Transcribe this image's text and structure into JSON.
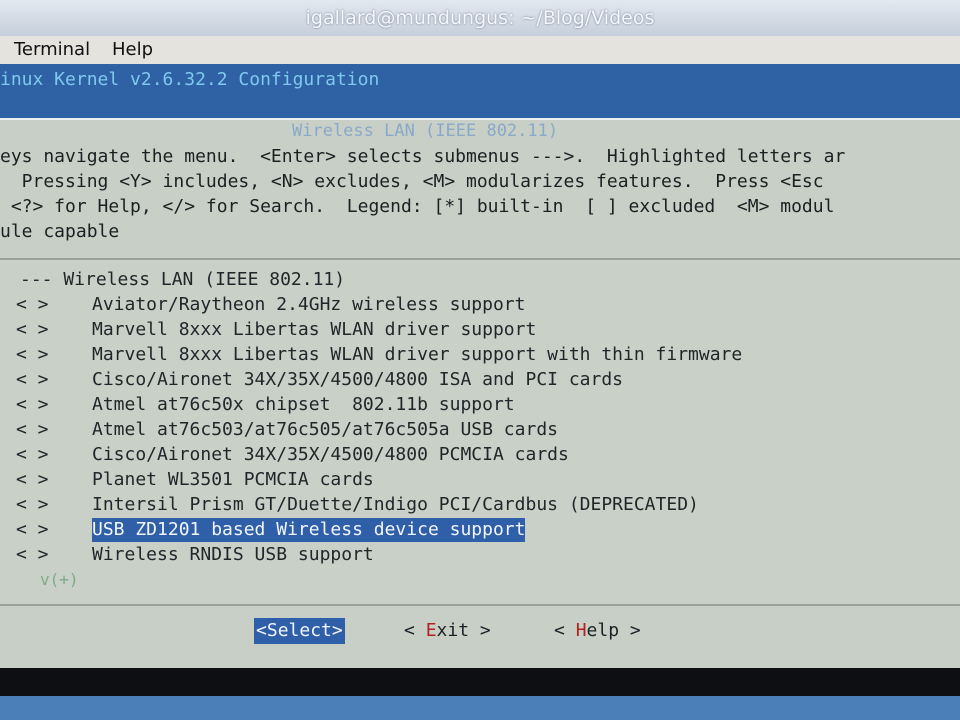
{
  "window": {
    "title": "igallard@mundungus: ~/Blog/Videos"
  },
  "menubar": {
    "terminal": "Terminal",
    "help": "Help"
  },
  "config": {
    "title": "inux Kernel v2.6.32.2 Configuration"
  },
  "dialog": {
    "header": "Wireless LAN (IEEE 802.11)",
    "help_lines": [
      "eys navigate the menu.  <Enter> selects submenus --->.  Highlighted letters ar",
      "  Pressing <Y> includes, <N> excludes, <M> modularizes features.  Press <Esc",
      " <?> for Help, </> for Search.  Legend: [*] built-in  [ ] excluded  <M> modul",
      "ule capable"
    ]
  },
  "menu": {
    "section": "--- Wireless LAN (IEEE 802.11)",
    "items": [
      {
        "mark": "< >",
        "label": "Aviator/Raytheon 2.4GHz wireless support"
      },
      {
        "mark": "< >",
        "label": "Marvell 8xxx Libertas WLAN driver support"
      },
      {
        "mark": "< >",
        "label": "Marvell 8xxx Libertas WLAN driver support with thin firmware"
      },
      {
        "mark": "< >",
        "label": "Cisco/Aironet 34X/35X/4500/4800 ISA and PCI cards"
      },
      {
        "mark": "< >",
        "label": "Atmel at76c50x chipset  802.11b support"
      },
      {
        "mark": "< >",
        "label": "Atmel at76c503/at76c505/at76c505a USB cards"
      },
      {
        "mark": "< >",
        "label": "Cisco/Aironet 34X/35X/4500/4800 PCMCIA cards"
      },
      {
        "mark": "< >",
        "label": "Planet WL3501 PCMCIA cards"
      },
      {
        "mark": "< >",
        "label": "Intersil Prism GT/Duette/Indigo PCI/Cardbus (DEPRECATED)"
      },
      {
        "mark": "< >",
        "label": "USB ZD1201 based Wireless device support",
        "selected": true
      },
      {
        "mark": "< >",
        "label": "Wireless RNDIS USB support"
      }
    ],
    "more_indicator": "v(+)"
  },
  "buttons": {
    "select": {
      "pre": "<",
      "hot": "S",
      "post": "elect>"
    },
    "exit": {
      "pre": "< ",
      "hot": "E",
      "post": "xit >"
    },
    "help": {
      "pre": "< ",
      "hot": "H",
      "post": "elp >"
    }
  },
  "colors": {
    "terminal_bg": "#2e62a4",
    "dialog_bg": "#c8cfc7",
    "highlight": "#2f5fa8",
    "hotkey": "#b22020"
  }
}
